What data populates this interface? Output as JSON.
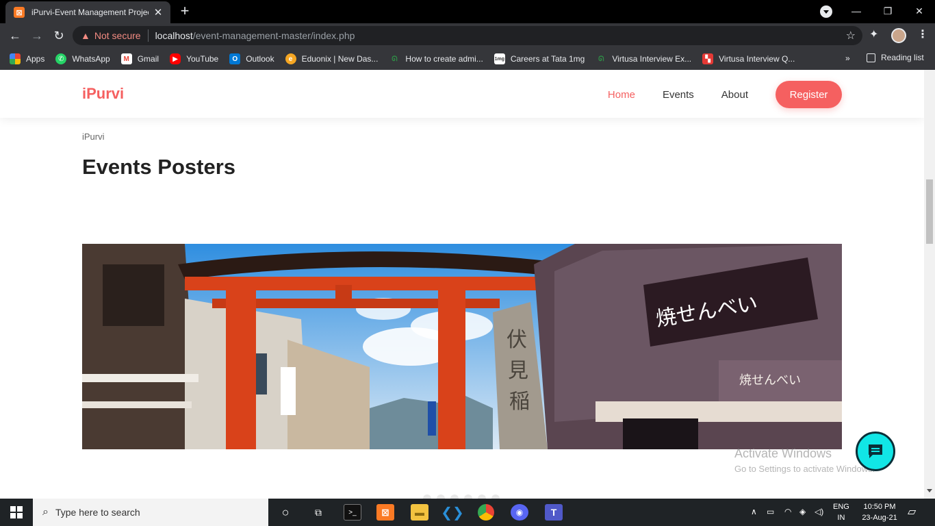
{
  "browser": {
    "tab_title": "iPurvi-Event Management Project",
    "tab_close": "✕",
    "new_tab": "+",
    "security_label": "Not secure",
    "url_host": "localhost",
    "url_path": "/event-management-master/index.php",
    "window_controls": [
      "—",
      "❐",
      "✕"
    ]
  },
  "bookmarks": [
    {
      "label": "Apps",
      "icon": "apps-grid-icon",
      "color": "#ea4335"
    },
    {
      "label": "WhatsApp",
      "icon": "whatsapp-icon",
      "color": "#25d366"
    },
    {
      "label": "Gmail",
      "icon": "gmail-icon",
      "color": "#ea4335"
    },
    {
      "label": "YouTube",
      "icon": "youtube-icon",
      "color": "#ff0000"
    },
    {
      "label": "Outlook",
      "icon": "outlook-icon",
      "color": "#0078d4"
    },
    {
      "label": "Eduonix | New Das...",
      "icon": "eduonix-icon",
      "color": "#f5a623"
    },
    {
      "label": "How to create admi...",
      "icon": "gfg-icon",
      "color": "#2f8d46"
    },
    {
      "label": "Careers at Tata 1mg",
      "icon": "tata1mg-icon",
      "color": "#ffffff"
    },
    {
      "label": "Virtusa Interview Ex...",
      "icon": "gfg-icon",
      "color": "#2f8d46"
    },
    {
      "label": "Virtusa Interview Q...",
      "icon": "virtusa-icon",
      "color": "#e53935"
    }
  ],
  "bookmarks_more": "»",
  "reading_list": "Reading list",
  "site": {
    "logo": "iPurvi",
    "nav": [
      "Home",
      "Events",
      "About"
    ],
    "register": "Register",
    "breadcrumb": "iPurvi",
    "heading_bold": "Events",
    "heading_rest": "Posters",
    "slide_count": 6
  },
  "activation": {
    "title": "Activate Windows",
    "subtitle": "Go to Settings to activate Windows."
  },
  "taskbar": {
    "search_placeholder": "Type here to search",
    "lang_top": "ENG",
    "lang_bottom": "IN",
    "time": "10:50 PM",
    "date": "23-Aug-21"
  },
  "colors": {
    "accent": "#f56060",
    "chat": "#11e6e6"
  }
}
